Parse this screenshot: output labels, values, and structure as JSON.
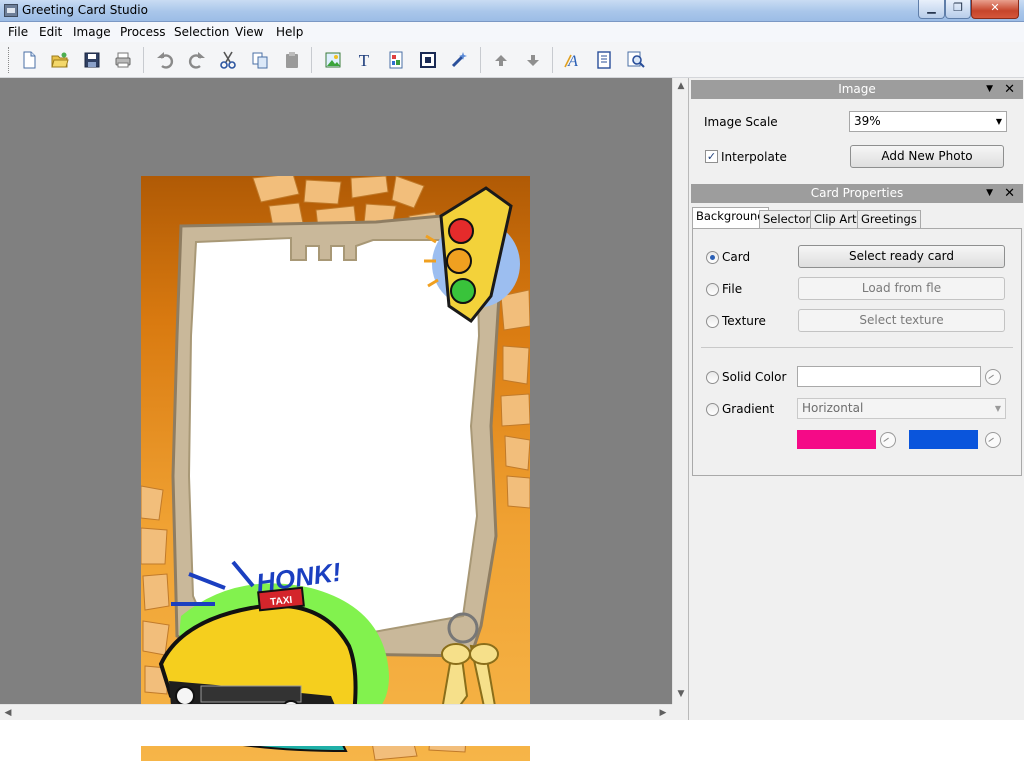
{
  "window": {
    "title": "Greeting Card Studio"
  },
  "menu": [
    "File",
    "Edit",
    "Image",
    "Process",
    "Selection",
    "View",
    "Help"
  ],
  "toolbar_icons": [
    "new-document-icon",
    "open-folder-icon",
    "save-icon",
    "print-icon",
    "undo-icon",
    "redo-icon",
    "cut-icon",
    "copy-icon",
    "paste-icon",
    "insert-image-icon",
    "insert-text-icon",
    "insert-clipart-icon",
    "insert-frame-icon",
    "magic-wand-icon",
    "bring-forward-icon",
    "send-backward-icon",
    "text-effects-icon",
    "card-preview-icon",
    "zoom-icon"
  ],
  "card": {
    "honk_text": "HONK!",
    "taxi_text": "TAXI"
  },
  "image_panel": {
    "header": "Image",
    "scale_label": "Image Scale",
    "scale_value": "39%",
    "interpolate_label": "Interpolate",
    "interpolate_checked": true,
    "add_photo_label": "Add New Photo"
  },
  "card_panel": {
    "header": "Card Properties",
    "tabs": [
      "Background",
      "Selector",
      "Clip Art",
      "Greetings"
    ],
    "active_tab": "Background",
    "options": {
      "card": {
        "label": "Card",
        "button": "Select ready card",
        "selected": true
      },
      "file": {
        "label": "File",
        "button": "Load from fle"
      },
      "texture": {
        "label": "Texture",
        "button": "Select texture"
      },
      "solid_color": {
        "label": "Solid Color"
      },
      "gradient": {
        "label": "Gradient",
        "value": "Horizontal"
      }
    },
    "gradient_colors": {
      "start": "#f50a87",
      "end": "#0a55dc"
    }
  }
}
